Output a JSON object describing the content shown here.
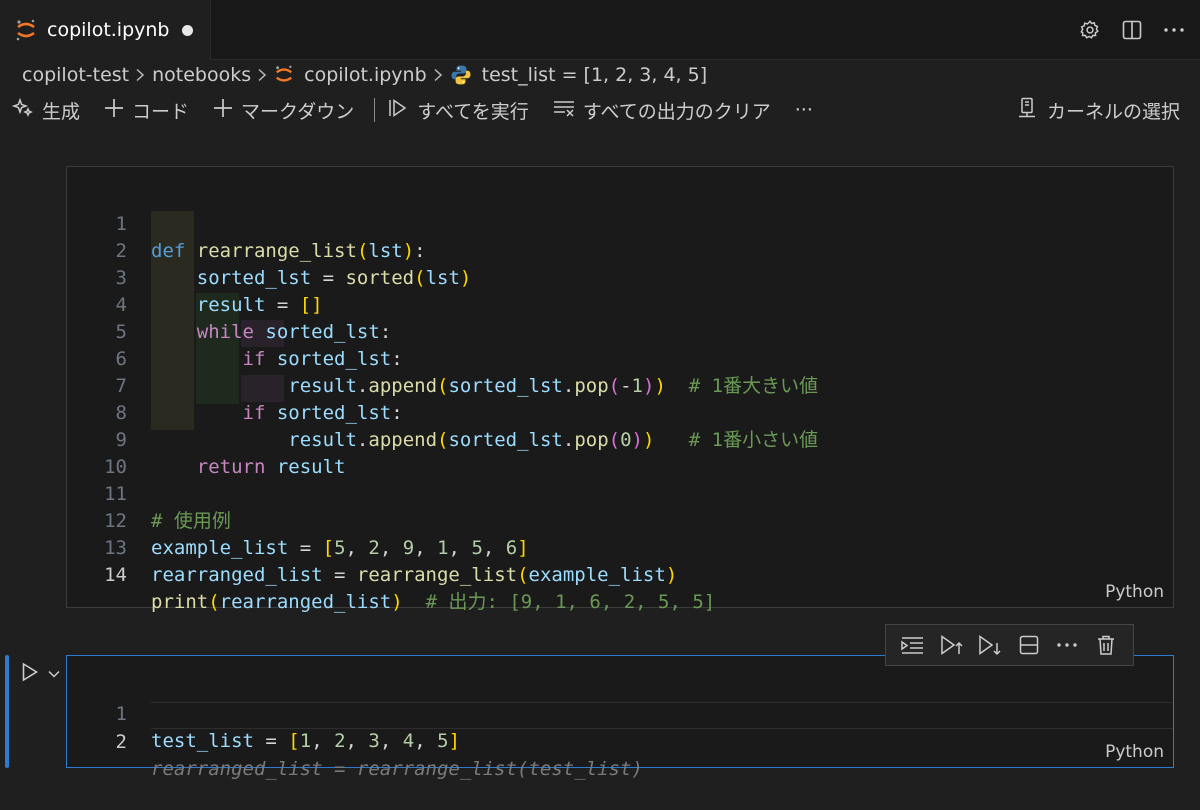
{
  "tab": {
    "title": "copilot.ipynb"
  },
  "breadcrumb": {
    "items": [
      "copilot-test",
      "notebooks",
      "copilot.ipynb",
      "test_list = [1, 2, 3, 4, 5]"
    ]
  },
  "toolbar": {
    "generate": "生成",
    "code": "コード",
    "markdown": "マークダウン",
    "run_all": "すべてを実行",
    "clear_outputs": "すべての出力のクリア",
    "more": "···",
    "select_kernel": "カーネルの選択"
  },
  "cell1": {
    "language": "Python",
    "line_numbers": [
      "1",
      "2",
      "3",
      "4",
      "5",
      "6",
      "7",
      "8",
      "9",
      "10",
      "11",
      "12",
      "13",
      "14"
    ],
    "lines": [
      "def rearrange_list(lst):",
      "    sorted_lst = sorted(lst)",
      "    result = []",
      "    while sorted_lst:",
      "        if sorted_lst:",
      "            result.append(sorted_lst.pop(-1))  # 1番大きい値",
      "        if sorted_lst:",
      "            result.append(sorted_lst.pop(0))   # 1番小さい値",
      "    return result",
      "",
      "# 使用例",
      "example_list = [5, 2, 9, 1, 5, 6]",
      "rearranged_list = rearrange_list(example_list)",
      "print(rearranged_list)  # 出力: [9, 1, 6, 2, 5, 5]"
    ]
  },
  "cell2": {
    "language": "Python",
    "line_numbers": [
      "1",
      "2"
    ],
    "lines": [
      "test_list = [1, 2, 3, 4, 5]"
    ],
    "ghost_suggestion": "rearranged_list = rearrange_list(test_list)"
  },
  "colors": {
    "accent": "#2f7bd2",
    "jupyter_orange": "#f37726"
  }
}
